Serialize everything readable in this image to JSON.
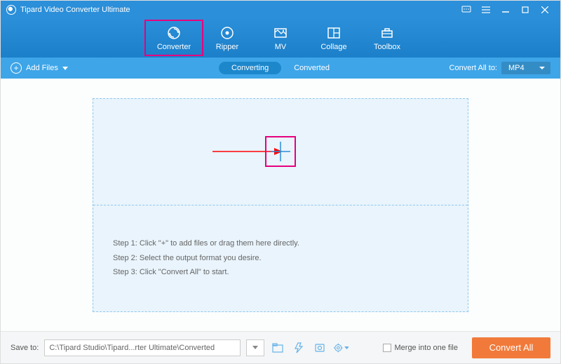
{
  "title": "Tipard Video Converter Ultimate",
  "nav": {
    "converter": "Converter",
    "ripper": "Ripper",
    "mv": "MV",
    "collage": "Collage",
    "toolbox": "Toolbox"
  },
  "subbar": {
    "add_files": "Add Files",
    "tab_converting": "Converting",
    "tab_converted": "Converted",
    "convert_all_to": "Convert All to:",
    "format": "MP4"
  },
  "steps": {
    "s1": "Step 1: Click \"+\" to add files or drag them here directly.",
    "s2": "Step 2: Select the output format you desire.",
    "s3": "Step 3: Click \"Convert All\" to start."
  },
  "bottom": {
    "save_to": "Save to:",
    "path": "C:\\Tipard Studio\\Tipard...rter Ultimate\\Converted",
    "merge": "Merge into one file",
    "convert_all": "Convert All"
  }
}
